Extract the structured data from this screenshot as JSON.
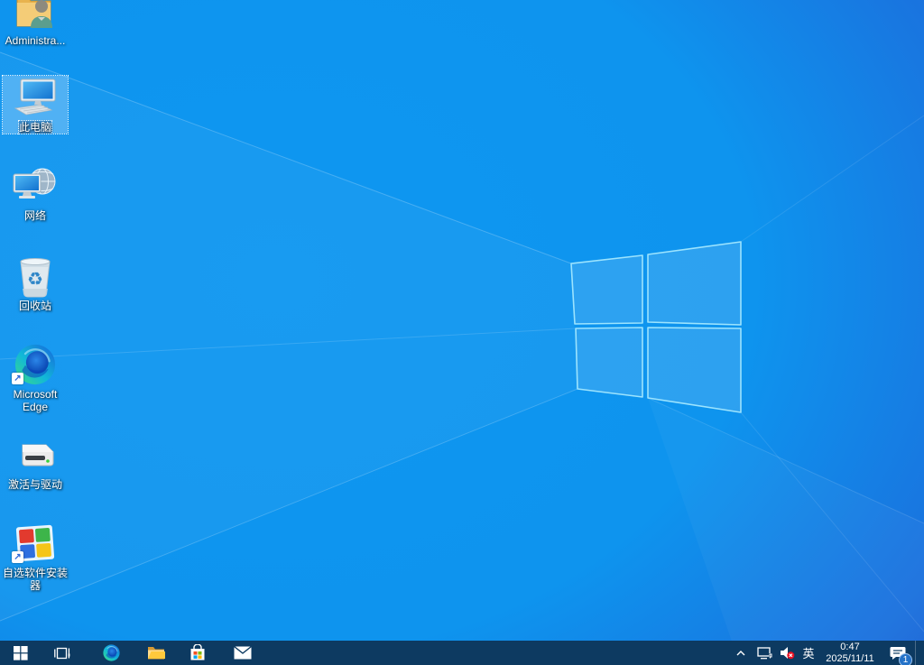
{
  "desktop": {
    "icons": [
      {
        "id": "administrator",
        "label": "Administra...",
        "icon": "user-folder-icon",
        "selected": false
      },
      {
        "id": "this-pc",
        "label": "此电脑",
        "icon": "computer-icon",
        "selected": true
      },
      {
        "id": "network",
        "label": "网络",
        "icon": "network-globe-icon",
        "selected": false
      },
      {
        "id": "recycle-bin",
        "label": "回收站",
        "icon": "recycle-bin-icon",
        "selected": false
      },
      {
        "id": "edge",
        "label": "Microsoft Edge",
        "icon": "edge-icon",
        "selected": false,
        "shortcut": true
      },
      {
        "id": "drivers",
        "label": "激活与驱动",
        "icon": "hard-drive-icon",
        "selected": false
      },
      {
        "id": "installer",
        "label": "自选软件安装器",
        "icon": "software-tiles-icon",
        "selected": false,
        "shortcut": true
      }
    ],
    "shortcut_arrow_glyph": "↗"
  },
  "taskbar": {
    "tray": {
      "ime_label": "英",
      "time": "0:47",
      "date": "2025/11/11",
      "notification_count": "1"
    }
  },
  "colors": {
    "taskbar_bg": "#0d3a61",
    "wallpaper_azure": "#0e95ef",
    "wallpaper_royal": "#1445c5",
    "logo_pane_border": "#8fe0fb",
    "badge_bg": "#2472c8",
    "mute_badge_red": "#e81123"
  }
}
